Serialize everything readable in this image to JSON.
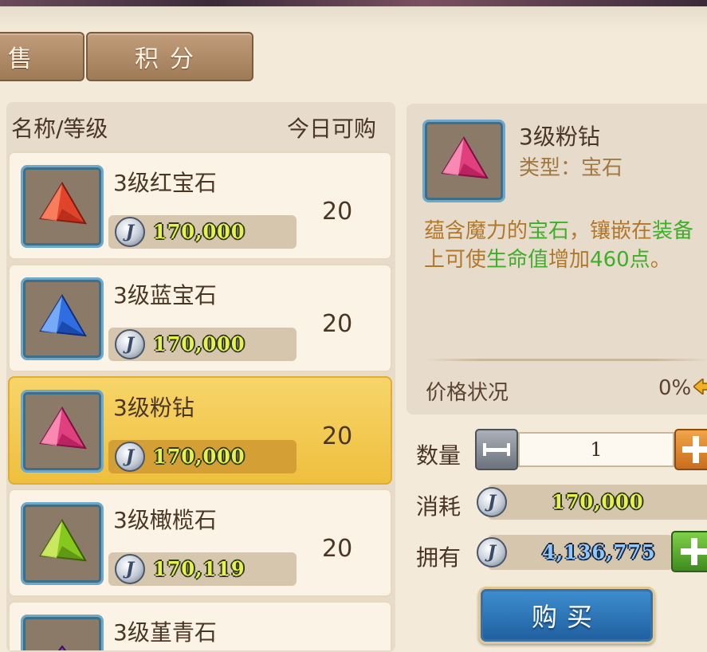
{
  "tabs": {
    "sell": "售",
    "points": "积分"
  },
  "list": {
    "header_name": "名称/等级",
    "header_buy": "今日可购",
    "items": [
      {
        "name": "3级红宝石",
        "price": "170,000",
        "qty": "20",
        "color": "#e0452c"
      },
      {
        "name": "3级蓝宝石",
        "price": "170,000",
        "qty": "20",
        "color": "#2f6ee0"
      },
      {
        "name": "3级粉钻",
        "price": "170,000",
        "qty": "20",
        "color": "#e0407e"
      },
      {
        "name": "3级橄榄石",
        "price": "170,119",
        "qty": "20",
        "color": "#86c81e"
      },
      {
        "name": "3级堇青石",
        "color": "#8a3fc0"
      }
    ]
  },
  "detail": {
    "name": "3级粉钻",
    "type": "类型：宝石",
    "desc": {
      "p1": "蕴含魔力的",
      "g1": "宝石",
      "p2": "，镶嵌在",
      "g2": "装备",
      "p3": "上可使",
      "g3": "生命值",
      "p4": "增加",
      "g4": "460点",
      "p5": "。"
    },
    "price_status_label": "价格状况",
    "price_status_value": "0%"
  },
  "purchase": {
    "qty_label": "数量",
    "qty_value": "1",
    "cost_label": "消耗",
    "cost_value": "170,000",
    "own_label": "拥有",
    "own_value": "4,136,775",
    "buy_label": "购买",
    "coin_glyph": "J"
  }
}
